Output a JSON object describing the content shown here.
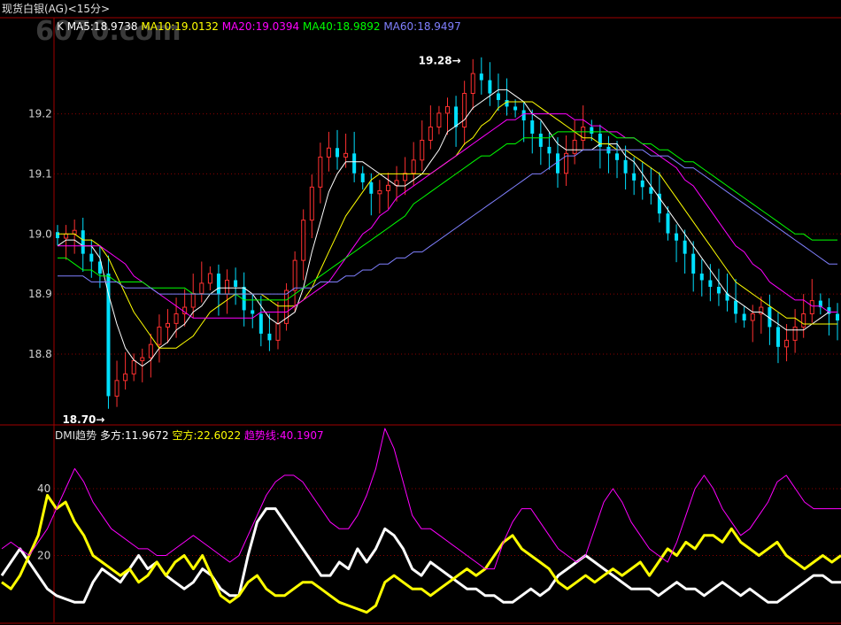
{
  "window": {
    "title": "现货白银(AG)<15分>",
    "watermark": "6070.com"
  },
  "chart_data": [
    {
      "type": "candlestick",
      "panel": "price",
      "legend_prefix": "K",
      "legend": [
        {
          "label": "MA5:18.9738",
          "color": "#ffffff"
        },
        {
          "label": "MA10:19.0132",
          "color": "#ffff00"
        },
        {
          "label": "MA20:19.0394",
          "color": "#ff00ff"
        },
        {
          "label": "MA40:18.9892",
          "color": "#00ff00"
        },
        {
          "label": "MA60:18.9497",
          "color": "#8080ff"
        }
      ],
      "ylim": [
        18.685,
        19.36
      ],
      "yticks": [
        "19.2",
        "19.1",
        "19.0",
        "18.9",
        "18.8"
      ],
      "annotations": [
        {
          "text": "19.28",
          "arrow": "→",
          "value": 19.28,
          "index": 48
        },
        {
          "text": "18.70",
          "arrow": "→",
          "value": 18.7,
          "index": 6
        }
      ],
      "colors": {
        "up": "#ff3030",
        "down": "#00e0ff",
        "grid": "#8b0000",
        "frame": "#a00000"
      },
      "series": {
        "close": [
          18.993,
          19.0,
          19.006,
          18.967,
          18.954,
          18.934,
          18.73,
          18.756,
          18.767,
          18.789,
          18.794,
          18.816,
          18.845,
          18.851,
          18.867,
          18.878,
          18.901,
          18.918,
          18.934,
          18.9,
          18.923,
          18.912,
          18.873,
          18.867,
          18.834,
          18.823,
          18.851,
          18.906,
          18.956,
          19.023,
          19.078,
          19.128,
          19.143,
          19.128,
          19.134,
          19.101,
          19.086,
          19.067,
          19.072,
          19.081,
          19.089,
          19.101,
          19.123,
          19.156,
          19.178,
          19.201,
          19.212,
          19.178,
          19.234,
          19.267,
          19.256,
          19.234,
          19.223,
          19.212,
          19.206,
          19.189,
          19.167,
          19.145,
          19.134,
          19.101,
          19.134,
          19.156,
          19.178,
          19.167,
          19.145,
          19.134,
          19.123,
          19.101,
          19.089,
          19.078,
          19.067,
          19.034,
          19.001,
          18.989,
          18.967,
          18.934,
          18.923,
          18.912,
          18.901,
          18.889,
          18.867,
          18.856,
          18.867,
          18.878,
          18.845,
          18.812,
          18.823,
          18.845,
          18.867,
          18.889,
          18.878,
          18.867,
          18.856
        ],
        "ma5": [
          18.98,
          18.99,
          18.99,
          18.98,
          18.98,
          18.96,
          18.9,
          18.85,
          18.81,
          18.79,
          18.78,
          18.79,
          18.81,
          18.82,
          18.84,
          18.85,
          18.87,
          18.88,
          18.9,
          18.91,
          18.91,
          18.91,
          18.91,
          18.9,
          18.88,
          18.86,
          18.85,
          18.86,
          18.87,
          18.91,
          18.97,
          19.02,
          19.07,
          19.1,
          19.12,
          19.12,
          19.12,
          19.11,
          19.1,
          19.09,
          19.08,
          19.08,
          19.09,
          19.1,
          19.12,
          19.14,
          19.17,
          19.18,
          19.19,
          19.21,
          19.22,
          19.23,
          19.24,
          19.24,
          19.23,
          19.22,
          19.2,
          19.19,
          19.17,
          19.15,
          19.14,
          19.14,
          19.14,
          19.14,
          19.15,
          19.15,
          19.15,
          19.13,
          19.12,
          19.1,
          19.08,
          19.06,
          19.04,
          19.02,
          19.0,
          18.98,
          18.96,
          18.94,
          18.92,
          18.9,
          18.89,
          18.88,
          18.87,
          18.87,
          18.86,
          18.85,
          18.84,
          18.84,
          18.84,
          18.85,
          18.86,
          18.87,
          18.87
        ],
        "ma10": [
          19.0,
          19.0,
          19.0,
          18.99,
          18.99,
          18.98,
          18.96,
          18.93,
          18.9,
          18.87,
          18.85,
          18.83,
          18.81,
          18.81,
          18.81,
          18.82,
          18.83,
          18.85,
          18.87,
          18.88,
          18.89,
          18.9,
          18.9,
          18.9,
          18.9,
          18.89,
          18.88,
          18.88,
          18.88,
          18.89,
          18.91,
          18.94,
          18.97,
          19.0,
          19.03,
          19.05,
          19.07,
          19.09,
          19.1,
          19.1,
          19.1,
          19.1,
          19.1,
          19.1,
          19.1,
          19.11,
          19.12,
          19.13,
          19.15,
          19.16,
          19.18,
          19.19,
          19.21,
          19.22,
          19.22,
          19.22,
          19.22,
          19.21,
          19.2,
          19.19,
          19.18,
          19.17,
          19.16,
          19.16,
          19.15,
          19.15,
          19.14,
          19.14,
          19.13,
          19.12,
          19.11,
          19.1,
          19.08,
          19.06,
          19.04,
          19.02,
          19.0,
          18.98,
          18.96,
          18.94,
          18.92,
          18.91,
          18.9,
          18.89,
          18.88,
          18.87,
          18.86,
          18.86,
          18.85,
          18.85,
          18.85,
          18.85,
          18.85
        ],
        "ma20": [
          18.98,
          18.98,
          18.98,
          18.98,
          18.98,
          18.98,
          18.97,
          18.96,
          18.95,
          18.93,
          18.92,
          18.91,
          18.9,
          18.89,
          18.88,
          18.87,
          18.86,
          18.86,
          18.86,
          18.86,
          18.86,
          18.86,
          18.86,
          18.86,
          18.87,
          18.87,
          18.87,
          18.87,
          18.88,
          18.89,
          18.9,
          18.91,
          18.92,
          18.94,
          18.96,
          18.98,
          19.0,
          19.01,
          19.03,
          19.04,
          19.06,
          19.07,
          19.08,
          19.09,
          19.1,
          19.11,
          19.12,
          19.13,
          19.14,
          19.15,
          19.16,
          19.17,
          19.18,
          19.19,
          19.19,
          19.2,
          19.2,
          19.2,
          19.2,
          19.2,
          19.2,
          19.19,
          19.19,
          19.18,
          19.18,
          19.17,
          19.17,
          19.16,
          19.16,
          19.15,
          19.14,
          19.13,
          19.12,
          19.11,
          19.09,
          19.08,
          19.06,
          19.04,
          19.02,
          19.0,
          18.98,
          18.97,
          18.95,
          18.94,
          18.92,
          18.91,
          18.9,
          18.89,
          18.89,
          18.88,
          18.88,
          18.87,
          18.87
        ],
        "ma40": [
          18.96,
          18.96,
          18.95,
          18.94,
          18.94,
          18.93,
          18.93,
          18.92,
          18.92,
          18.92,
          18.92,
          18.91,
          18.91,
          18.91,
          18.91,
          18.91,
          18.9,
          18.9,
          18.9,
          18.9,
          18.9,
          18.9,
          18.89,
          18.89,
          18.89,
          18.89,
          18.89,
          18.89,
          18.9,
          18.91,
          18.92,
          18.93,
          18.94,
          18.95,
          18.96,
          18.97,
          18.98,
          18.99,
          19.0,
          19.01,
          19.02,
          19.03,
          19.05,
          19.06,
          19.07,
          19.08,
          19.09,
          19.1,
          19.11,
          19.12,
          19.13,
          19.13,
          19.14,
          19.15,
          19.15,
          19.16,
          19.16,
          19.16,
          19.16,
          19.17,
          19.17,
          19.17,
          19.17,
          19.17,
          19.17,
          19.17,
          19.16,
          19.16,
          19.16,
          19.15,
          19.15,
          19.14,
          19.14,
          19.13,
          19.12,
          19.12,
          19.11,
          19.1,
          19.09,
          19.08,
          19.07,
          19.06,
          19.05,
          19.04,
          19.03,
          19.02,
          19.01,
          19.0,
          19.0,
          18.99,
          18.99,
          18.99,
          18.99
        ],
        "ma60": [
          18.93,
          18.93,
          18.93,
          18.93,
          18.92,
          18.92,
          18.92,
          18.92,
          18.91,
          18.91,
          18.91,
          18.91,
          18.9,
          18.9,
          18.9,
          18.9,
          18.9,
          18.9,
          18.9,
          18.9,
          18.9,
          18.9,
          18.9,
          18.9,
          18.9,
          18.9,
          18.9,
          18.9,
          18.91,
          18.91,
          18.91,
          18.92,
          18.92,
          18.92,
          18.93,
          18.93,
          18.94,
          18.94,
          18.95,
          18.95,
          18.96,
          18.96,
          18.97,
          18.97,
          18.98,
          18.99,
          19.0,
          19.01,
          19.02,
          19.03,
          19.04,
          19.05,
          19.06,
          19.07,
          19.08,
          19.09,
          19.1,
          19.1,
          19.11,
          19.12,
          19.13,
          19.13,
          19.14,
          19.14,
          19.14,
          19.14,
          19.14,
          19.14,
          19.14,
          19.14,
          19.13,
          19.13,
          19.13,
          19.12,
          19.11,
          19.11,
          19.1,
          19.09,
          19.08,
          19.07,
          19.06,
          19.05,
          19.04,
          19.03,
          19.02,
          19.01,
          19.0,
          18.99,
          18.98,
          18.97,
          18.96,
          18.95,
          18.95
        ]
      }
    },
    {
      "type": "line",
      "panel": "indicator",
      "legend": [
        {
          "label": "DMI趋势",
          "color": "#e0e0e0"
        },
        {
          "label": "多方:11.9672",
          "color": "#ffffff"
        },
        {
          "label": "空方:22.6022",
          "color": "#ffff00"
        },
        {
          "label": "趋势线:40.1907",
          "color": "#ff00ff"
        }
      ],
      "ylim": [
        0,
        58
      ],
      "yticks": [
        "40",
        "20"
      ],
      "series": [
        {
          "name": "多方",
          "color": "#ffffff",
          "values": [
            14,
            18,
            22,
            18,
            14,
            10,
            8,
            7,
            6,
            6,
            12,
            16,
            14,
            12,
            16,
            20,
            16,
            18,
            14,
            12,
            10,
            12,
            16,
            14,
            10,
            8,
            8,
            20,
            30,
            34,
            34,
            30,
            26,
            22,
            18,
            14,
            14,
            18,
            16,
            22,
            18,
            22,
            28,
            26,
            22,
            16,
            14,
            18,
            16,
            14,
            12,
            10,
            10,
            8,
            8,
            6,
            6,
            8,
            10,
            8,
            10,
            14,
            16,
            18,
            20,
            18,
            16,
            14,
            12,
            10,
            10,
            10,
            8,
            10,
            12,
            10,
            10,
            8,
            10,
            12,
            10,
            8,
            10,
            8,
            6,
            6,
            8,
            10,
            12,
            14,
            14,
            12,
            12
          ]
        },
        {
          "name": "空方",
          "color": "#ffff00",
          "values": [
            12,
            10,
            14,
            20,
            26,
            38,
            34,
            36,
            30,
            26,
            20,
            18,
            16,
            14,
            16,
            12,
            14,
            18,
            14,
            18,
            20,
            16,
            20,
            14,
            8,
            6,
            8,
            12,
            14,
            10,
            8,
            8,
            10,
            12,
            12,
            10,
            8,
            6,
            5,
            4,
            3,
            5,
            12,
            14,
            12,
            10,
            10,
            8,
            10,
            12,
            14,
            16,
            14,
            16,
            20,
            24,
            26,
            22,
            20,
            18,
            16,
            12,
            10,
            12,
            14,
            12,
            14,
            16,
            14,
            16,
            18,
            14,
            18,
            22,
            20,
            24,
            22,
            26,
            26,
            24,
            28,
            24,
            22,
            20,
            22,
            24,
            20,
            18,
            16,
            18,
            20,
            18,
            20
          ]
        },
        {
          "name": "趋势线",
          "color": "#ff00ff",
          "values": [
            22,
            24,
            22,
            20,
            24,
            28,
            34,
            40,
            46,
            42,
            36,
            32,
            28,
            26,
            24,
            22,
            22,
            20,
            20,
            22,
            24,
            26,
            24,
            22,
            20,
            18,
            20,
            26,
            32,
            38,
            42,
            44,
            44,
            42,
            38,
            34,
            30,
            28,
            28,
            32,
            38,
            46,
            58,
            52,
            42,
            32,
            28,
            28,
            26,
            24,
            22,
            20,
            18,
            16,
            16,
            24,
            30,
            34,
            34,
            30,
            26,
            22,
            20,
            18,
            20,
            28,
            36,
            40,
            36,
            30,
            26,
            22,
            20,
            18,
            24,
            32,
            40,
            44,
            40,
            34,
            30,
            26,
            28,
            32,
            36,
            42,
            44,
            40,
            36,
            34,
            34,
            34,
            34
          ]
        }
      ]
    }
  ]
}
